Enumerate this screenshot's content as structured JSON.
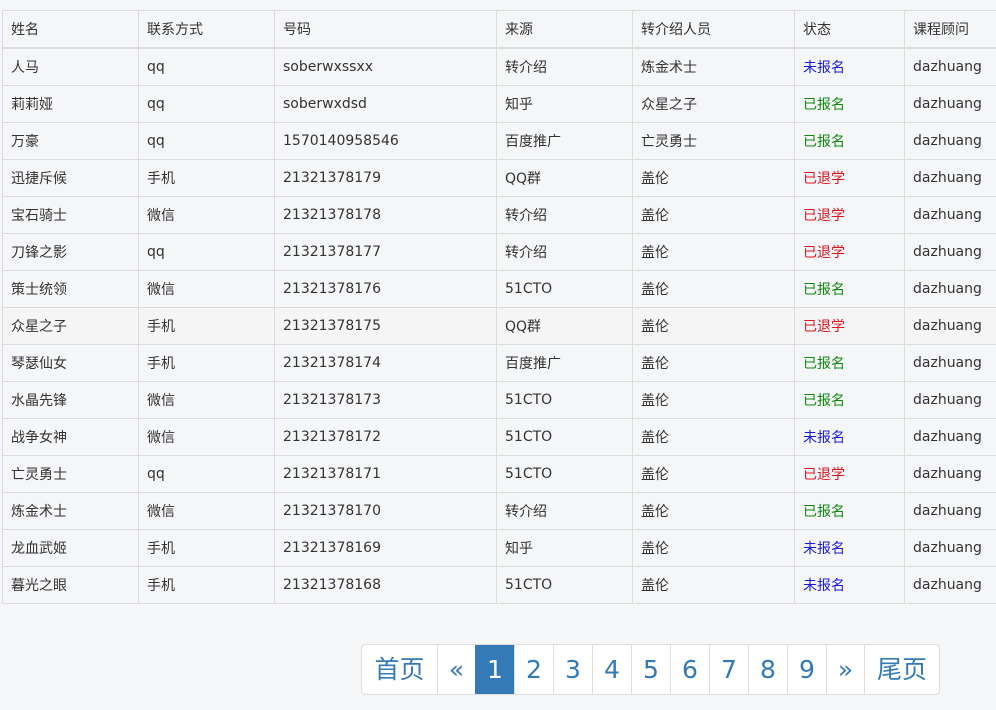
{
  "table": {
    "headers": [
      "姓名",
      "联系方式",
      "号码",
      "来源",
      "转介绍人员",
      "状态",
      "课程顾问"
    ],
    "rows": [
      {
        "name": "人马",
        "contact": "qq",
        "number": "soberwxssxx",
        "source": "转介绍",
        "referrer": "炼金术士",
        "status": "未报名",
        "status_class": "st-blue",
        "advisor": "dazhuang"
      },
      {
        "name": "莉莉娅",
        "contact": "qq",
        "number": "soberwxdsd",
        "source": "知乎",
        "referrer": "众星之子",
        "status": "已报名",
        "status_class": "st-green",
        "advisor": "dazhuang"
      },
      {
        "name": "万豪",
        "contact": "qq",
        "number": "1570140958546",
        "source": "百度推广",
        "referrer": "亡灵勇士",
        "status": "已报名",
        "status_class": "st-green",
        "advisor": "dazhuang"
      },
      {
        "name": "迅捷斥候",
        "contact": "手机",
        "number": "21321378179",
        "source": "QQ群",
        "referrer": "盖伦",
        "status": "已退学",
        "status_class": "st-red",
        "advisor": "dazhuang"
      },
      {
        "name": "宝石骑士",
        "contact": "微信",
        "number": "21321378178",
        "source": "转介绍",
        "referrer": "盖伦",
        "status": "已退学",
        "status_class": "st-red",
        "advisor": "dazhuang"
      },
      {
        "name": "刀锋之影",
        "contact": "qq",
        "number": "21321378177",
        "source": "转介绍",
        "referrer": "盖伦",
        "status": "已退学",
        "status_class": "st-red",
        "advisor": "dazhuang"
      },
      {
        "name": "策士统领",
        "contact": "微信",
        "number": "21321378176",
        "source": "51CTO",
        "referrer": "盖伦",
        "status": "已报名",
        "status_class": "st-green",
        "advisor": "dazhuang"
      },
      {
        "name": "众星之子",
        "contact": "手机",
        "number": "21321378175",
        "source": "QQ群",
        "referrer": "盖伦",
        "status": "已退学",
        "status_class": "st-red",
        "advisor": "dazhuang"
      },
      {
        "name": "琴瑟仙女",
        "contact": "手机",
        "number": "21321378174",
        "source": "百度推广",
        "referrer": "盖伦",
        "status": "已报名",
        "status_class": "st-green",
        "advisor": "dazhuang"
      },
      {
        "name": "水晶先锋",
        "contact": "微信",
        "number": "21321378173",
        "source": "51CTO",
        "referrer": "盖伦",
        "status": "已报名",
        "status_class": "st-green",
        "advisor": "dazhuang"
      },
      {
        "name": "战争女神",
        "contact": "微信",
        "number": "21321378172",
        "source": "51CTO",
        "referrer": "盖伦",
        "status": "未报名",
        "status_class": "st-blue",
        "advisor": "dazhuang"
      },
      {
        "name": "亡灵勇士",
        "contact": "qq",
        "number": "21321378171",
        "source": "51CTO",
        "referrer": "盖伦",
        "status": "已退学",
        "status_class": "st-red",
        "advisor": "dazhuang"
      },
      {
        "name": "炼金术士",
        "contact": "微信",
        "number": "21321378170",
        "source": "转介绍",
        "referrer": "盖伦",
        "status": "已报名",
        "status_class": "st-green",
        "advisor": "dazhuang"
      },
      {
        "name": "龙血武姬",
        "contact": "手机",
        "number": "21321378169",
        "source": "知乎",
        "referrer": "盖伦",
        "status": "未报名",
        "status_class": "st-blue",
        "advisor": "dazhuang"
      },
      {
        "name": "暮光之眼",
        "contact": "手机",
        "number": "21321378168",
        "source": "51CTO",
        "referrer": "盖伦",
        "status": "未报名",
        "status_class": "st-blue",
        "advisor": "dazhuang"
      }
    ]
  },
  "status_colors": {
    "未报名": "#1a1adb",
    "已报名": "#0e8a0e",
    "已退学": "#e0141e"
  },
  "pagination": {
    "first": "首页",
    "prev": "«",
    "pages": [
      "1",
      "2",
      "3",
      "4",
      "5",
      "6",
      "7",
      "8",
      "9"
    ],
    "active_page": "1",
    "next": "»",
    "last": "尾页",
    "active_color": "#337ab7"
  }
}
